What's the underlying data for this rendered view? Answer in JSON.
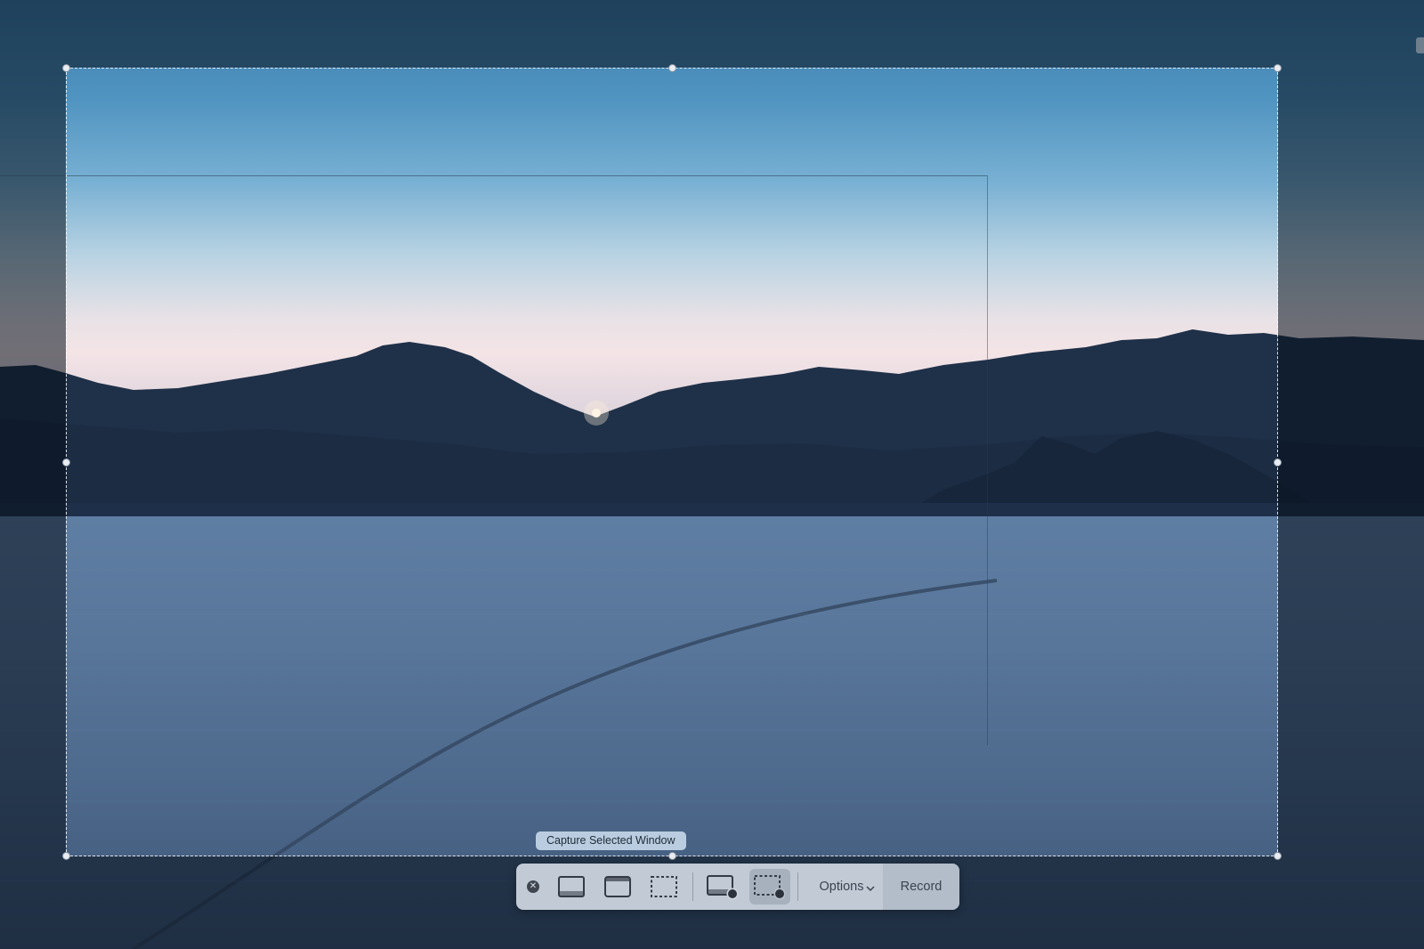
{
  "capture_tooltip": "Capture Selected Window",
  "toolbar": {
    "close_icon": "close-icon",
    "buttons": [
      {
        "name": "capture-entire-screen",
        "icon": "screen-icon",
        "active": false
      },
      {
        "name": "capture-selected-window",
        "icon": "window-icon",
        "active": false
      },
      {
        "name": "capture-selected-portion",
        "icon": "selection-icon",
        "active": false
      },
      {
        "name": "record-entire-screen",
        "icon": "record-screen-icon",
        "active": false
      },
      {
        "name": "record-selected-portion",
        "icon": "record-selection-icon",
        "active": true
      }
    ],
    "options_label": "Options",
    "options_icon": "chevron-down-icon",
    "record_label": "Record"
  }
}
